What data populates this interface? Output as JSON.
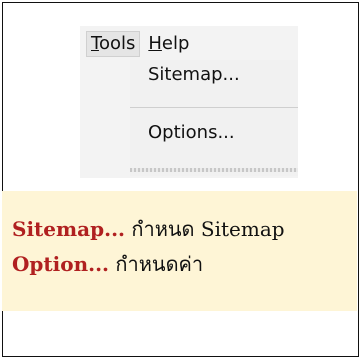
{
  "menubar": {
    "items": [
      {
        "label": "Tools",
        "mnemonic": "T",
        "rest": "ools",
        "active": true
      },
      {
        "label": "Help",
        "mnemonic": "H",
        "rest": "elp",
        "active": false
      }
    ]
  },
  "dropdown": {
    "items": [
      {
        "label": "Sitemap..."
      },
      {
        "label": "Options..."
      }
    ]
  },
  "description": {
    "lines": [
      {
        "keyword": "Sitemap...",
        "text": " กำหนด Sitemap"
      },
      {
        "keyword": "Option...",
        "text": " กำหนดค่า"
      }
    ]
  },
  "colors": {
    "keyword": "#b02020",
    "description_bg": "#fef5d6",
    "menu_bg": "#f3f3f3"
  }
}
